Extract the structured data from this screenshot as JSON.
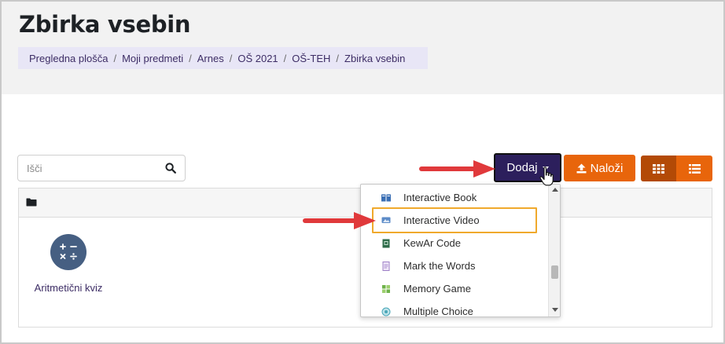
{
  "page": {
    "title": "Zbirka vsebin"
  },
  "breadcrumb": [
    "Pregledna plošča",
    "Moji predmeti",
    "Arnes",
    "OŠ 2021",
    "OŠ-TEH",
    "Zbirka vsebin"
  ],
  "breadcrumb_separator": "/",
  "search": {
    "placeholder": "Išči",
    "value": ""
  },
  "toolbar": {
    "add_label": "Dodaj",
    "upload_label": "Naloži",
    "grid_view_icon": "grid-icon",
    "list_view_icon": "list-icon"
  },
  "content": {
    "folder_icon": "folder-icon",
    "items": [
      {
        "label": "Aritmetični kviz",
        "icon": "arithmetic-icon"
      }
    ]
  },
  "dropdown": {
    "items": [
      {
        "label": "Interactive Book",
        "icon": "book-icon"
      },
      {
        "label": "Interactive Video",
        "icon": "video-icon",
        "highlighted": true
      },
      {
        "label": "KewAr Code",
        "icon": "qr-code-icon"
      },
      {
        "label": "Mark the Words",
        "icon": "document-icon"
      },
      {
        "label": "Memory Game",
        "icon": "tiles-icon"
      },
      {
        "label": "Multiple Choice",
        "icon": "radio-icon"
      }
    ]
  },
  "colors": {
    "brand_purple": "#2c1f5c",
    "accent_orange": "#e8650b",
    "accent_orange_dark": "#b34a06",
    "highlight": "#f0a92c",
    "annotation_arrow": "#e0393b",
    "breadcrumb_bg": "#e8e6f6",
    "header_bg": "#f2f2f2"
  }
}
